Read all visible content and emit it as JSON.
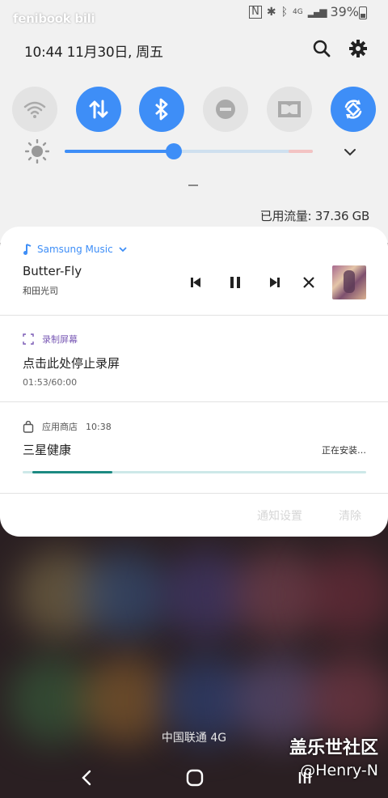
{
  "status_bar": {
    "brand": "fenibook",
    "brand_suffix": "bili",
    "signal_text": "4G",
    "battery_percent": "39%"
  },
  "header": {
    "datetime": "10:44  11月30日, 周五"
  },
  "quick_settings": {
    "toggles": [
      {
        "name": "wifi",
        "state": "off"
      },
      {
        "name": "mobile-data",
        "state": "on"
      },
      {
        "name": "bluetooth",
        "state": "on"
      },
      {
        "name": "do-not-disturb",
        "state": "off"
      },
      {
        "name": "dolby",
        "state": "off"
      },
      {
        "name": "auto-rotate",
        "state": "on"
      }
    ],
    "brightness_level": 0.44
  },
  "data_usage": "已用流量: 37.36 GB",
  "music": {
    "app_name": "Samsung Music",
    "title": "Butter-Fly",
    "artist": "和田光司"
  },
  "screen_record": {
    "app_name": "录制屏幕",
    "title": "点击此处停止录屏",
    "time": "01:53/60:00"
  },
  "app_store": {
    "app_name": "应用商店",
    "time": "10:38",
    "title": "三星健康",
    "status": "正在安装…",
    "progress": 0.24
  },
  "footer": {
    "settings_label": "通知设置",
    "clear_label": "清除"
  },
  "carrier": "中国联通 4G",
  "watermark": {
    "site": "盖乐世社区",
    "user": "@Henry-N"
  },
  "colors": {
    "accent": "#3e8ef7",
    "panel_bg": "#f1f1f1",
    "progress": "#1c8a82"
  }
}
